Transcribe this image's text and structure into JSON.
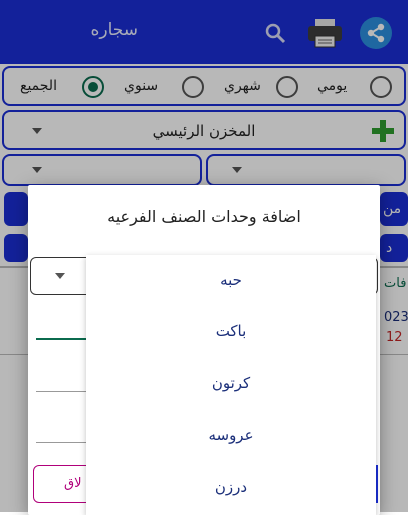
{
  "app_bar": {
    "title": "سجاره"
  },
  "period_options": [
    {
      "label": "يومي",
      "selected": false
    },
    {
      "label": "شهري",
      "selected": false
    },
    {
      "label": "سنوي",
      "selected": false
    },
    {
      "label": "الجميع",
      "selected": true
    }
  ],
  "store_select": {
    "label": "المخزن الرئيسي"
  },
  "background": {
    "from_label": "من",
    "partial_right": "د",
    "partial_left_1": "فات",
    "partial_left_2": "023",
    "partial_left_3": "12",
    "close_partial": "لاق"
  },
  "dialog": {
    "title": "اضافة وحدات الصنف الفرعيه",
    "units": [
      "حبه",
      "باكت",
      "كرتون",
      "عروسه",
      "درزن"
    ]
  },
  "colors": {
    "primary": "#1b2fd6",
    "accent": "#0b6b4e",
    "add": "#2e9d2e"
  }
}
